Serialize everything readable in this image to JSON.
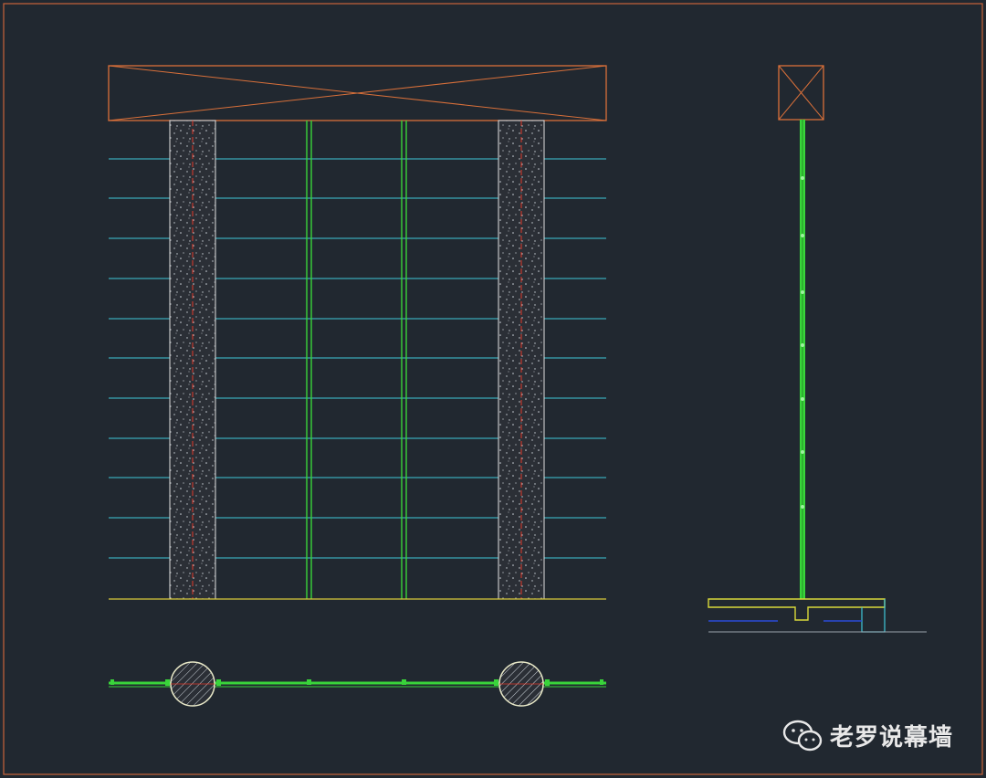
{
  "watermark": {
    "icon": "wechat-icon",
    "text": "老罗说幕墙"
  },
  "colors": {
    "background": "#212830",
    "frame": "#c8633a",
    "beam": "#d9703a",
    "column_fill": "#2b2f36",
    "column_edge": "#e0e0e0",
    "column_axis": "#e03a2a",
    "glass_fin": "#39d43a",
    "transom": "#3fc9d9",
    "ground": "#d9c93a",
    "slab_outline": "#d9d93a",
    "blue_line": "#2a4bd9",
    "watermark_text": "#e8e8e8"
  }
}
